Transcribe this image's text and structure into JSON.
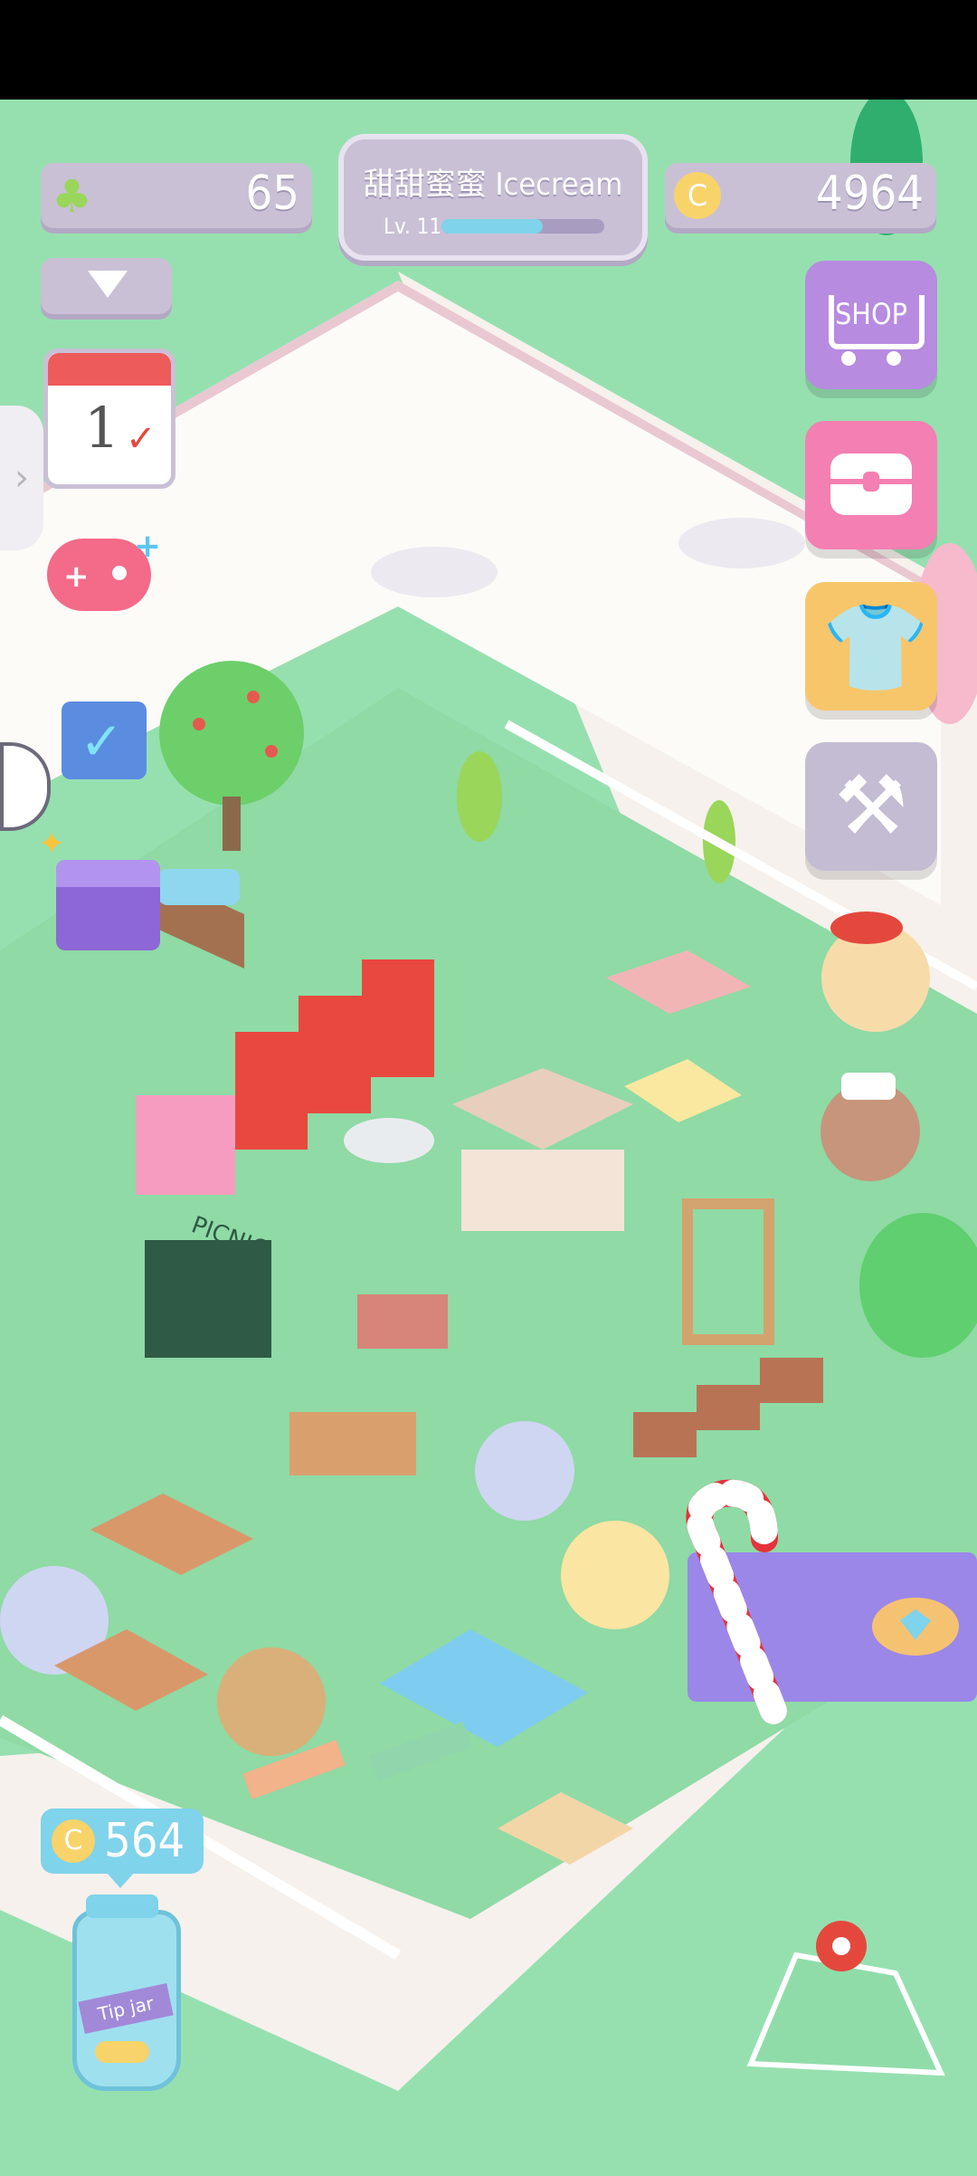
{
  "header": {
    "clover_count": "65",
    "player_name": "甜甜蜜蜜 Icecream",
    "level_label": "Lv. 11",
    "level_progress": 0.62,
    "coins": "4964"
  },
  "right_menu": {
    "shop_label": "SHOP"
  },
  "left_menu": {
    "calendar_day": "1"
  },
  "map": {
    "picnic_sign": "PICNIC"
  },
  "tip_jar": {
    "amount": "564",
    "label": "Tip jar"
  },
  "colors": {
    "grass": "#96e0b0",
    "plaza": "#fdfbf8",
    "hud_purple": "#c9c0d6",
    "shop_purple": "#b78be0",
    "chest_pink": "#f47fb2",
    "shirt_yellow": "#f7c66a",
    "tools_grey": "#c4bcd2",
    "level_bar": "#7fd3ea",
    "coin_gold": "#f7d36a"
  },
  "icons": [
    "clover-icon",
    "coin-icon",
    "dropdown-arrow-icon",
    "calendar-icon",
    "gamepad-icon",
    "checklist-icon",
    "gift-box-icon",
    "shop-cart-icon",
    "treasure-chest-icon",
    "tshirt-icon",
    "tools-icon",
    "candy-cane-icon",
    "gem-icon",
    "map-icon",
    "tip-jar-icon"
  ]
}
